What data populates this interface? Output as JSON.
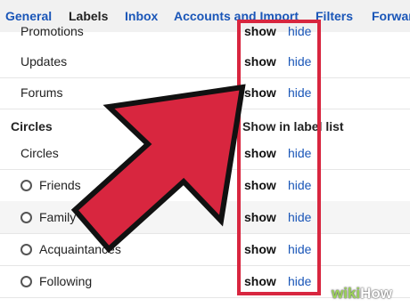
{
  "tabs": [
    "General",
    "Labels",
    "Inbox",
    "Accounts and Import",
    "Filters",
    "Forwar"
  ],
  "active_tab": "Labels",
  "rows": [
    {
      "label": "Promotions",
      "show": "show",
      "hide": "hide"
    },
    {
      "label": "Updates",
      "show": "show",
      "hide": "hide"
    },
    {
      "label": "Forums",
      "show": "show",
      "hide": "hide"
    }
  ],
  "circles_header": {
    "label": "Circles",
    "column": "Show in label list"
  },
  "circles": [
    {
      "label": "Circles",
      "show": "show",
      "hide": "hide"
    },
    {
      "label": "Friends",
      "show": "show",
      "hide": "hide"
    },
    {
      "label": "Family",
      "show": "show",
      "hide": "hide"
    },
    {
      "label": "Acquaintances",
      "show": "show",
      "hide": "hide"
    },
    {
      "label": "Following",
      "show": "show",
      "hide": "hide"
    }
  ],
  "watermark": {
    "prefix": "wiki",
    "suffix": "How"
  },
  "colors": {
    "link": "#1a56b8",
    "highlight": "#d8263f"
  }
}
